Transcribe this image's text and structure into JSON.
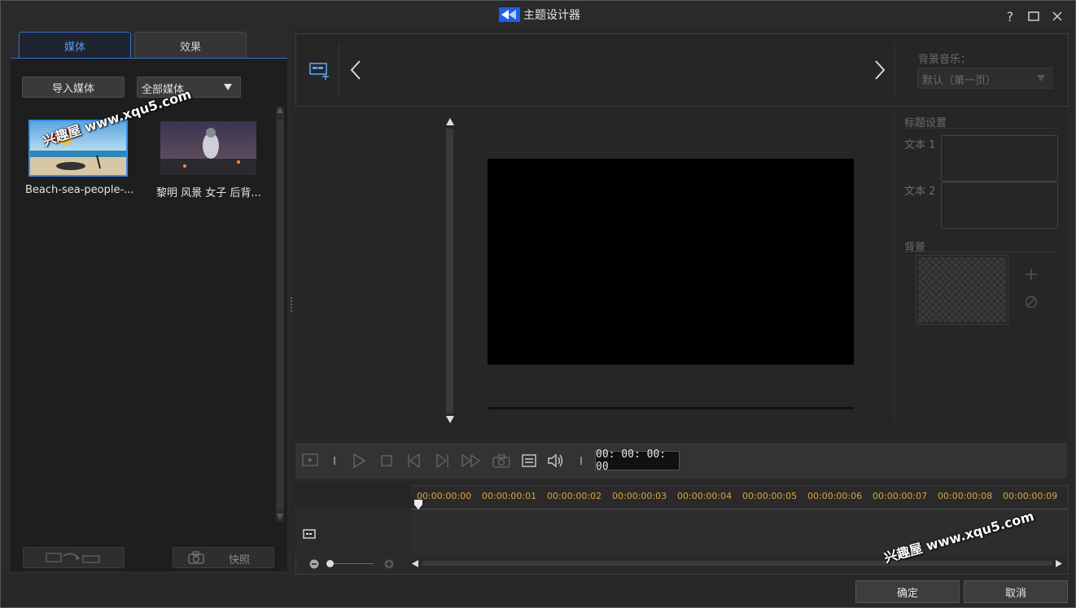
{
  "window": {
    "title": "主题设计器",
    "help": "?",
    "maximize": "☐",
    "close": "✕"
  },
  "left": {
    "tabs": [
      {
        "label": "媒体"
      },
      {
        "label": "效果"
      }
    ],
    "import_button": "导入媒体",
    "filter_value": "全部媒体",
    "media": [
      {
        "label": "Beach-sea-people-..."
      },
      {
        "label": "黎明 风景 女子 后背..."
      }
    ],
    "snapshot_button": "快照"
  },
  "top": {
    "bgmusic_label": "背景音乐：",
    "bgmusic_value": "默认（第一页）"
  },
  "side": {
    "title_settings": "标题设置",
    "text1": "文本 1",
    "text2": "文本 2",
    "background": "背景"
  },
  "player": {
    "timecode": "00: 00: 00: 00"
  },
  "timeline": {
    "marks": [
      "00:00:00:00",
      "00:00:00:01",
      "00:00:00:02",
      "00:00:00:03",
      "00:00:00:04",
      "00:00:00:05",
      "00:00:00:06",
      "00:00:00:07",
      "00:00:00:08",
      "00:00:00:09"
    ]
  },
  "footer": {
    "ok": "确定",
    "cancel": "取消"
  },
  "watermark": {
    "text1": "兴趣屋 www.xqu5.com",
    "text2": "兴趣屋 www.xqu5.com"
  },
  "colors": {
    "accent": "#3a6fd0",
    "timecode_gold": "#d9a440",
    "playhead": "#d63030"
  }
}
